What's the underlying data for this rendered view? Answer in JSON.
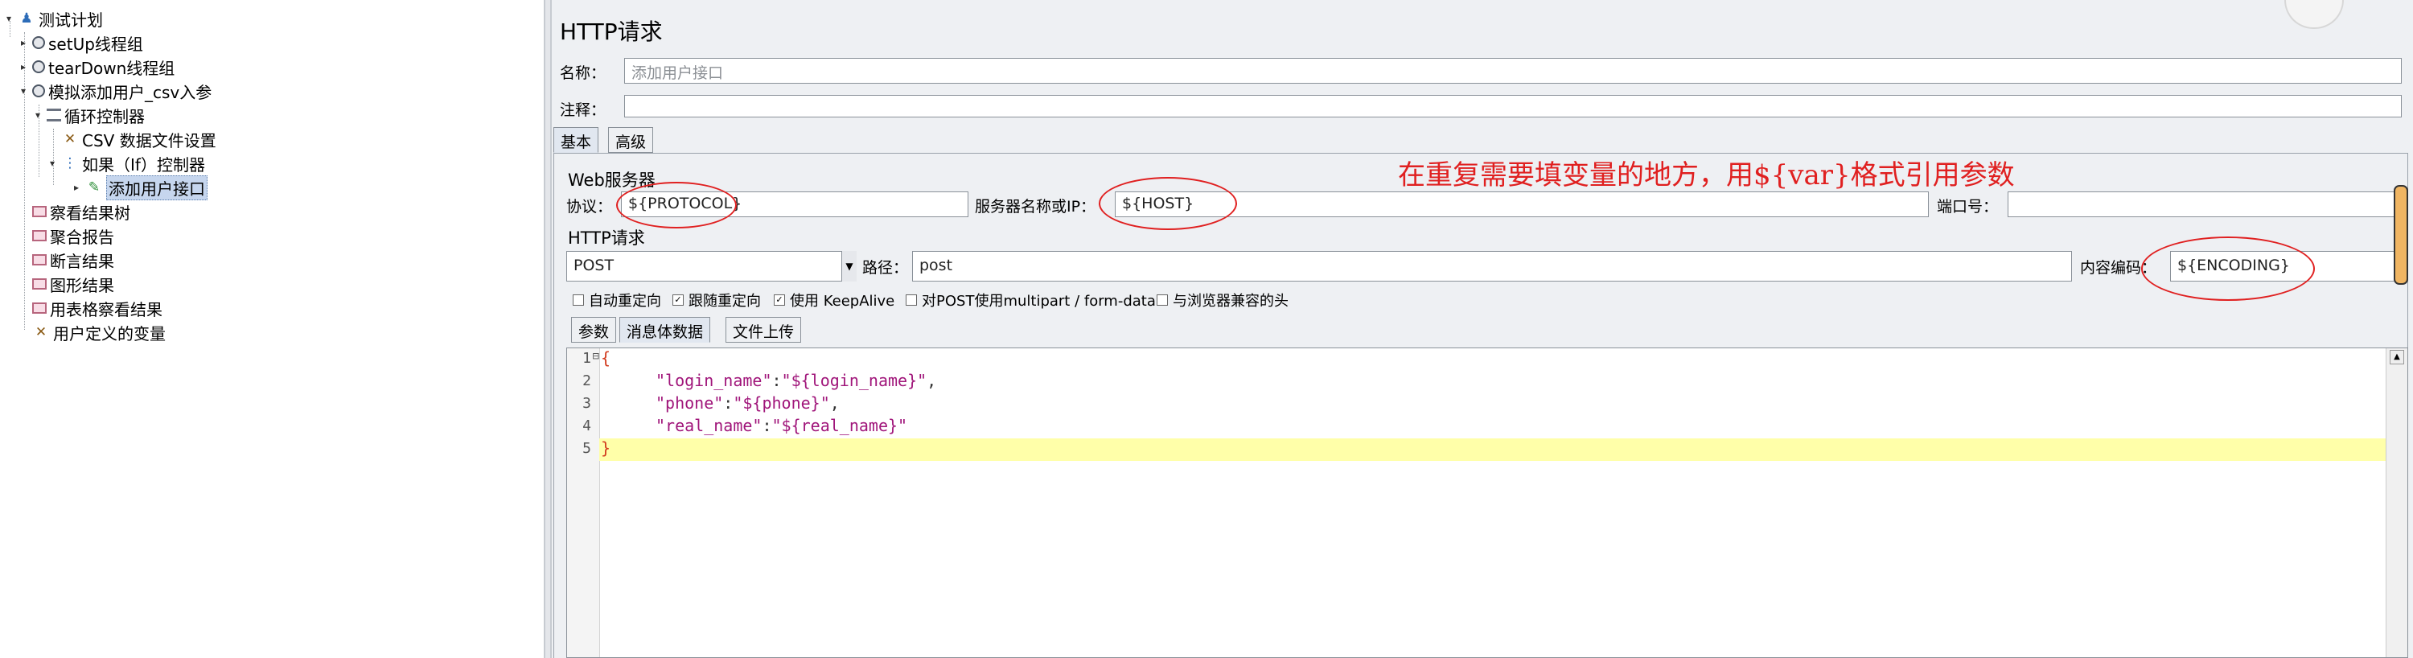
{
  "tree": {
    "items": [
      {
        "label": "测试计划"
      },
      {
        "label": "setUp线程组"
      },
      {
        "label": "tearDown线程组"
      },
      {
        "label": "模拟添加用户_csv入参"
      },
      {
        "label": "循环控制器"
      },
      {
        "label": "CSV 数据文件设置"
      },
      {
        "label": "如果（If）控制器"
      },
      {
        "label": "添加用户接口"
      },
      {
        "label": "察看结果树"
      },
      {
        "label": "聚合报告"
      },
      {
        "label": "断言结果"
      },
      {
        "label": "图形结果"
      },
      {
        "label": "用表格察看结果"
      },
      {
        "label": "用户定义的变量"
      }
    ]
  },
  "panel": {
    "title": "HTTP请求",
    "name_label": "名称：",
    "name_value": "添加用户接口",
    "comment_label": "注释："
  },
  "tabs": [
    {
      "label": "基本"
    },
    {
      "label": "高级"
    }
  ],
  "web_server": {
    "section": "Web服务器",
    "protocol_label": "协议：",
    "protocol_value": "${PROTOCOL}",
    "server_label": "服务器名称或IP：",
    "server_value": "${HOST}",
    "port_label": "端口号："
  },
  "http_request": {
    "section": "HTTP请求",
    "method": "POST",
    "path_label": "路径：",
    "path_value": "post",
    "encoding_label": "内容编码：",
    "encoding_value": "${ENCODING}"
  },
  "options": [
    {
      "label": "自动重定向",
      "checked": false,
      "mark": ""
    },
    {
      "label": "跟随重定向",
      "checked": true,
      "mark": "✓"
    },
    {
      "label": "使用 KeepAlive",
      "checked": true,
      "mark": "✓"
    },
    {
      "label": "对POST使用multipart / form-data",
      "checked": false,
      "mark": ""
    },
    {
      "label": "与浏览器兼容的头",
      "checked": false,
      "mark": ""
    }
  ],
  "body_tabs": [
    {
      "label": "参数"
    },
    {
      "label": "消息体数据"
    },
    {
      "label": "文件上传"
    }
  ],
  "editor": {
    "line_numbers": [
      "1",
      "2",
      "3",
      "4",
      "5"
    ],
    "fold_marker": "⊟",
    "open_brace": "{",
    "close_brace": "}",
    "fields": [
      {
        "key": "\"login_name\"",
        "colon": ":",
        "value": "\"${login_name}\"",
        "comma": ","
      },
      {
        "key": "\"phone\"",
        "colon": ":",
        "value": "\"${phone}\"",
        "comma": ","
      },
      {
        "key": "\"real_name\"",
        "colon": ":",
        "value": "\"${real_name}\"",
        "comma": ""
      }
    ]
  },
  "annotation": {
    "text": "在重复需要填变量的地方，用${var}格式引用参数",
    "color": "#e02020"
  },
  "icons": {
    "plan": "test-plan-icon",
    "thread": "gear-icon",
    "controller": "loop-icon",
    "config": "wrench-icon",
    "sampler": "sampler-pen-icon",
    "listener": "chart-icon"
  }
}
